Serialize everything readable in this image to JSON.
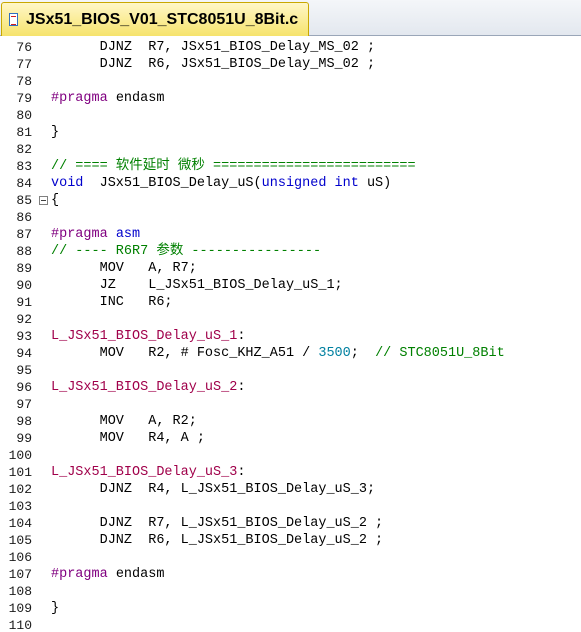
{
  "tab": {
    "title": "JSx51_BIOS_V01_STC8051U_8Bit.c",
    "icon": "c-source-file-icon"
  },
  "lines": [
    {
      "n": "76",
      "tokens": [
        [
          "t",
          "      DJNZ  R7, JSx51_BIOS_Delay_MS_02 ;"
        ]
      ]
    },
    {
      "n": "77",
      "tokens": [
        [
          "t",
          "      DJNZ  R6, JSx51_BIOS_Delay_MS_02 ;"
        ]
      ]
    },
    {
      "n": "78",
      "tokens": []
    },
    {
      "n": "79",
      "tokens": [
        [
          "pp",
          "#pragma"
        ],
        [
          "t",
          " endasm"
        ]
      ]
    },
    {
      "n": "80",
      "tokens": []
    },
    {
      "n": "81",
      "tokens": [
        [
          "t",
          "}"
        ]
      ]
    },
    {
      "n": "82",
      "tokens": []
    },
    {
      "n": "83",
      "tokens": [
        [
          "cm",
          "// ==== 软件延时 微秒 ========================="
        ]
      ]
    },
    {
      "n": "84",
      "tokens": [
        [
          "kw",
          "void"
        ],
        [
          "t",
          "  JSx51_BIOS_Delay_uS("
        ],
        [
          "kw",
          "unsigned int"
        ],
        [
          "t",
          " uS)"
        ]
      ]
    },
    {
      "n": "85",
      "tokens": [
        [
          "t",
          "{"
        ]
      ]
    },
    {
      "n": "86",
      "tokens": []
    },
    {
      "n": "87",
      "tokens": [
        [
          "pp",
          "#pragma"
        ],
        [
          "t",
          " "
        ],
        [
          "kw",
          "asm"
        ]
      ]
    },
    {
      "n": "88",
      "tokens": [
        [
          "cm",
          "// ---- R6R7 参数 ----------------"
        ]
      ]
    },
    {
      "n": "89",
      "tokens": [
        [
          "t",
          "      MOV   A, R7;"
        ]
      ]
    },
    {
      "n": "90",
      "tokens": [
        [
          "t",
          "      JZ    L_JSx51_BIOS_Delay_uS_1;"
        ]
      ]
    },
    {
      "n": "91",
      "tokens": [
        [
          "t",
          "      INC   R6;"
        ]
      ]
    },
    {
      "n": "92",
      "tokens": []
    },
    {
      "n": "93",
      "tokens": [
        [
          "lbl",
          "L_JSx51_BIOS_Delay_uS_1"
        ],
        [
          "t",
          ":"
        ]
      ]
    },
    {
      "n": "94",
      "tokens": [
        [
          "t",
          "      MOV   R2, # Fosc_KHZ_A51 / "
        ],
        [
          "num",
          "3500"
        ],
        [
          "t",
          ";  "
        ],
        [
          "cm",
          "// STC8051U_8Bit"
        ]
      ]
    },
    {
      "n": "95",
      "tokens": []
    },
    {
      "n": "96",
      "tokens": [
        [
          "lbl",
          "L_JSx51_BIOS_Delay_uS_2"
        ],
        [
          "t",
          ":"
        ]
      ]
    },
    {
      "n": "97",
      "tokens": []
    },
    {
      "n": "98",
      "tokens": [
        [
          "t",
          "      MOV   A, R2;"
        ]
      ]
    },
    {
      "n": "99",
      "tokens": [
        [
          "t",
          "      MOV   R4, A ;"
        ]
      ]
    },
    {
      "n": "100",
      "tokens": []
    },
    {
      "n": "101",
      "tokens": [
        [
          "lbl",
          "L_JSx51_BIOS_Delay_uS_3"
        ],
        [
          "t",
          ":"
        ]
      ]
    },
    {
      "n": "102",
      "tokens": [
        [
          "t",
          "      DJNZ  R4, L_JSx51_BIOS_Delay_uS_3;"
        ]
      ]
    },
    {
      "n": "103",
      "tokens": []
    },
    {
      "n": "104",
      "tokens": [
        [
          "t",
          "      DJNZ  R7, L_JSx51_BIOS_Delay_uS_2 ;"
        ]
      ]
    },
    {
      "n": "105",
      "tokens": [
        [
          "t",
          "      DJNZ  R6, L_JSx51_BIOS_Delay_uS_2 ;"
        ]
      ]
    },
    {
      "n": "106",
      "tokens": []
    },
    {
      "n": "107",
      "tokens": [
        [
          "pp",
          "#pragma"
        ],
        [
          "t",
          " endasm"
        ]
      ]
    },
    {
      "n": "108",
      "tokens": []
    },
    {
      "n": "109",
      "tokens": [
        [
          "t",
          "}"
        ]
      ]
    },
    {
      "n": "110",
      "tokens": []
    }
  ],
  "colors": {
    "keyword": "#0000cc",
    "preprocessor": "#800080",
    "comment": "#008000",
    "label": "#a0004a",
    "number": "#0080a0",
    "tab_active": "#f6e36c"
  }
}
